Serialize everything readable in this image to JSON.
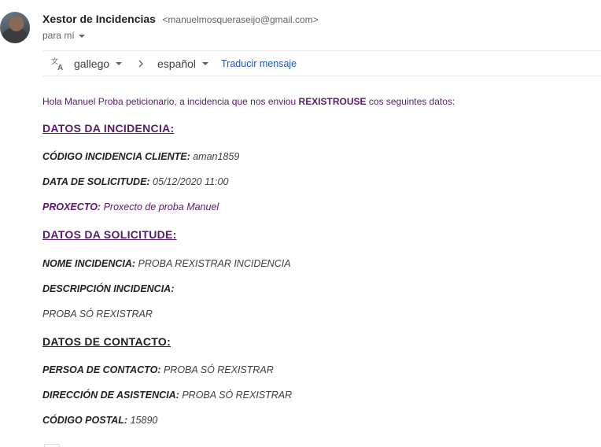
{
  "header": {
    "sender_name": "Xestor de Incidencias",
    "sender_email": "<manuelmosqueraseijo@gmail.com>",
    "recipient": "para mí"
  },
  "translate": {
    "from_language": "gallego",
    "to_language": "español",
    "link_label": "Traducir mensaje"
  },
  "message": {
    "greeting_prefix": "Hola Manuel Proba peticionario, a incidencia que nos enviou ",
    "greeting_highlight": "REXISTROUSE",
    "greeting_suffix": " cos seguintes datos:",
    "section1_title": "DATOS DA INCIDENCIA:",
    "codigo_label": "CÓDIGO INCIDENCIA CLIENTE:",
    "codigo_value": " aman1859",
    "data_label": "DATA DE SOLICITUDE:",
    "data_value": " 05/12/2020 11:00",
    "proxecto_label": "PROXECTO:",
    "proxecto_value": " Proxecto de proba Manuel",
    "section2_title": "DATOS DA SOLICITUDE:",
    "nome_label": "NOME INCIDENCIA:",
    "nome_value": " PROBA REXISTRAR INCIDENCIA",
    "descricion_label": "DESCRIPCIÓN INCIDENCIA:",
    "descricion_value": "PROBA SÓ REXISTRAR",
    "section3_title": "DATOS DE CONTACTO:",
    "persoa_label": "PERSOA DE CONTACTO:",
    "persoa_value": " PROBA SÓ REXISTRAR",
    "direccion_label": "DIRECCIÓN DE ASISTENCIA:",
    "direccion_value": " PROBA SÓ REXISTRAR",
    "cp_label": "CÓDIGO POSTAL:",
    "cp_value": " 15890"
  },
  "colors": {
    "accent_purple": "#5a1a6b",
    "link_blue": "#1a57c8",
    "text_dark": "#202124",
    "text_muted": "#5f6368"
  },
  "icons": [
    "sender-avatar",
    "recipient-caret-icon",
    "translate-icon",
    "chevron-down-icon",
    "chevron-right-icon"
  ]
}
